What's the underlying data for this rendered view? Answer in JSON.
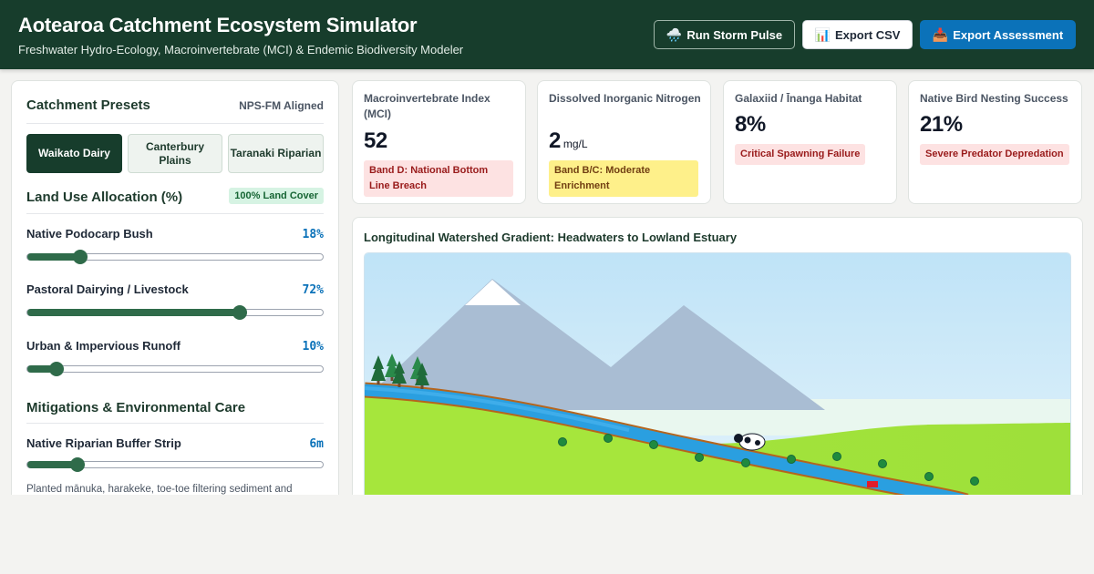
{
  "header": {
    "title": "Aotearoa Catchment Ecosystem Simulator",
    "subtitle": "Freshwater Hydro-Ecology, Macroinvertebrate (MCI) & Endemic Biodiversity Modeler",
    "buttons": {
      "storm": {
        "icon": "🌧️",
        "label": "Run Storm Pulse"
      },
      "csv": {
        "icon": "📊",
        "label": "Export CSV"
      },
      "assessment": {
        "icon": "📥",
        "label": "Export Assessment"
      }
    }
  },
  "presets": {
    "title": "Catchment Presets",
    "badge": "NPS-FM Aligned",
    "items": [
      {
        "label": "Waikato Dairy",
        "active": true
      },
      {
        "label": "Canterbury Plains",
        "active": false
      },
      {
        "label": "Taranaki Riparian",
        "active": false
      }
    ]
  },
  "land_use": {
    "title": "Land Use Allocation (%)",
    "badge": "100% Land Cover",
    "sliders": [
      {
        "label": "Native Podocarp Bush",
        "display": "18%",
        "value": 18,
        "max": 100
      },
      {
        "label": "Pastoral Dairying / Livestock",
        "display": "72%",
        "value": 72,
        "max": 100
      },
      {
        "label": "Urban & Impervious Runoff",
        "display": "10%",
        "value": 10,
        "max": 100
      }
    ]
  },
  "mitigations": {
    "title": "Mitigations & Environmental Care",
    "sliders": [
      {
        "label": "Native Riparian Buffer Strip",
        "display": "6m",
        "value": 0.17
      }
    ],
    "note": "Planted mānuka, harakeke, toe-toe filtering sediment and"
  },
  "metrics": [
    {
      "label": "Macroinvertebrate Index (MCI)",
      "value": "52",
      "unit": "",
      "badge": "Band D: National Bottom Line Breach",
      "badge_color": "red"
    },
    {
      "label": "Dissolved Inorganic Nitrogen",
      "value": "2",
      "unit": "mg/L",
      "badge": "Band B/C: Moderate Enrichment",
      "badge_color": "yellow"
    },
    {
      "label": "Galaxiid / Īnanga Habitat",
      "value": "8%",
      "unit": "",
      "badge": "Critical Spawning Failure",
      "badge_color": "red"
    },
    {
      "label": "Native Bird Nesting Success",
      "value": "21%",
      "unit": "",
      "badge": "Severe Predator Depredation",
      "badge_color": "red"
    }
  ],
  "watershed": {
    "title": "Longitudinal Watershed Gradient: Headwaters to Lowland Estuary",
    "colors": {
      "sky": "#bfe3f7",
      "mountain": "#a9bdd3",
      "snow": "#ffffff",
      "pasture": "#a6e63c",
      "river": "#2a9fe0",
      "riverbank": "#b5651d",
      "tree": "#1f6b3a"
    }
  },
  "colors": {
    "brand_dark": "#173d2c",
    "accent_blue": "#0b72b9",
    "slider_fill": "#2f6b4a"
  }
}
